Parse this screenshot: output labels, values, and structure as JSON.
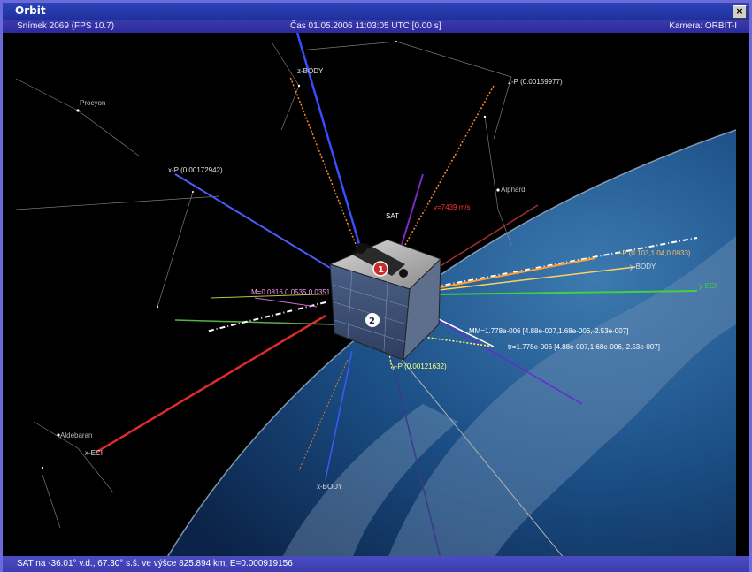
{
  "window": {
    "title": "Orbit",
    "close_glyph": "×"
  },
  "status": {
    "frame": "Snímek 2069 (FPS 10.7)",
    "time": "Čas 01.05.2006 11:03:05 UTC [0.00 s]",
    "camera": "Kamera: ORBIT-I"
  },
  "bottom": {
    "text": "SAT na -36.01° v.d., 67.30° s.š. ve výšce 825.894 km, E=0.000919156"
  },
  "scene": {
    "sat_label": "SAT",
    "stars": [
      "Procyon",
      "Alphard",
      "Aldebaran"
    ],
    "labels": {
      "zbody_top": "z-BODY",
      "zp_right": "z-P (0.00159977)",
      "xp_left": "x-P (0.00172942)",
      "velocity": "v=7439 m/s",
      "rp_right": "r-P (0.103,1.04,0.0933)",
      "ybody": "y-BODY",
      "yeci": "y-ECI",
      "m_left": "M=0.0816,0.0535,0.0351",
      "mm": "MM=1.778e-006 [4.88e-007,1.68e-006,-2.53e-007]",
      "tr": "tr=1.778e-006 [4.88e-007,1.68e-006,-2.53e-007]",
      "yp": "y-P (0.00121632)",
      "xeci": "x-ECI",
      "xbody": "x-BODY"
    },
    "face_numbers": [
      "1",
      "2"
    ]
  },
  "colors": {
    "accent": "#2c44b8",
    "velocity": "#ff4040",
    "earth_ocean": "#1b4f86"
  }
}
